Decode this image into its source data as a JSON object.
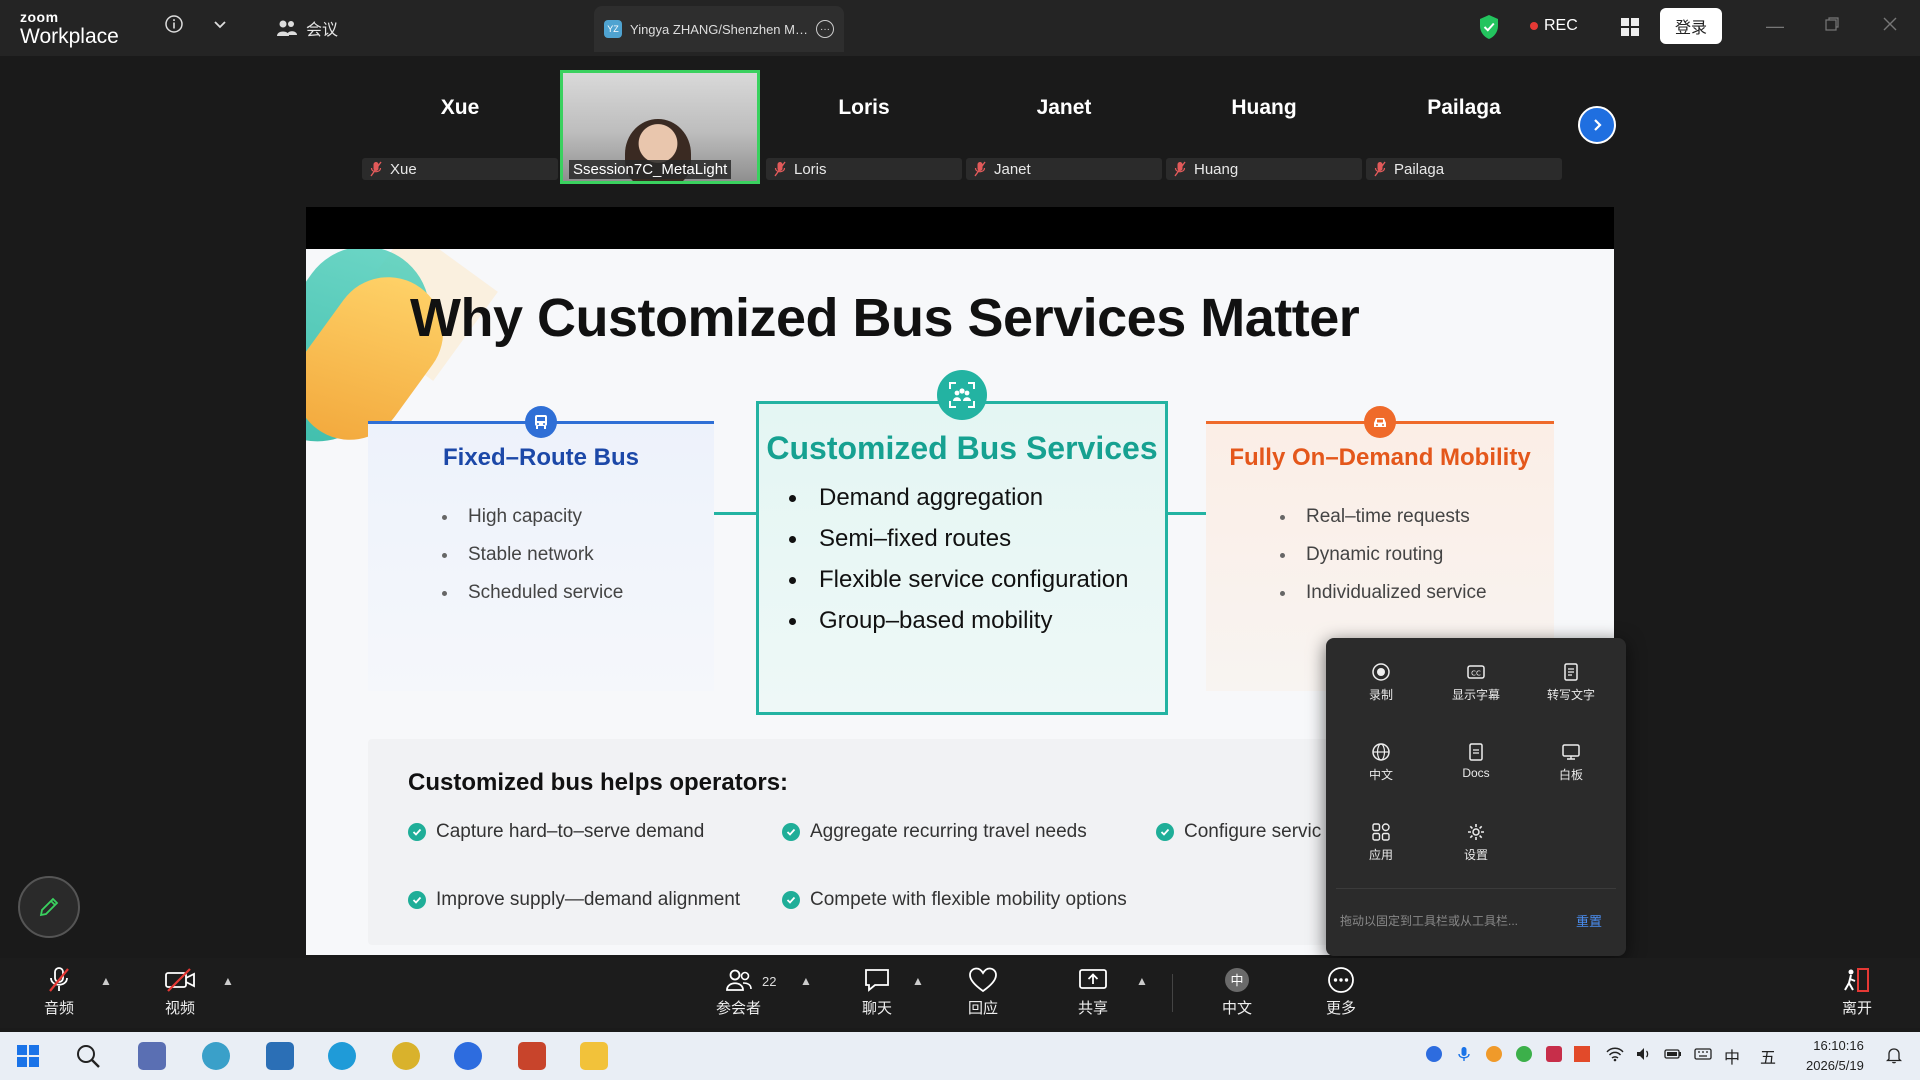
{
  "app": {
    "brand_small": "zoom",
    "brand_big": "Workplace"
  },
  "header": {
    "meeting_label": "会议",
    "tab_badge": "YZ",
    "tab_title": "Yingya ZHANG/Shenzhen Metrol",
    "rec_label": "REC",
    "login_label": "登录"
  },
  "participants": [
    {
      "name": "Xue",
      "label": "Xue"
    },
    {
      "name": "Loris",
      "label": "Loris"
    },
    {
      "name": "Janet",
      "label": "Janet"
    },
    {
      "name": "Huang",
      "label": "Huang"
    },
    {
      "name": "Pailaga",
      "label": "Pailaga"
    }
  ],
  "active_video": {
    "label": "Ssession7C_MetaLight"
  },
  "slide": {
    "title": "Why Customized Bus Services Matter",
    "left": {
      "title": "Fixed–Route Bus",
      "items": [
        "High capacity",
        "Stable network",
        "Scheduled service"
      ]
    },
    "center": {
      "title": "Customized Bus Services",
      "items": [
        "Demand aggregation",
        "Semi–fixed routes",
        "Flexible service configuration",
        "Group–based mobility"
      ]
    },
    "right": {
      "title": "Fully On–Demand Mobility",
      "items": [
        "Real–time requests",
        "Dynamic routing",
        "Individualized service"
      ]
    },
    "ops_title": "Customized bus helps operators:",
    "ops_items": [
      "Capture hard–to–serve demand",
      "Aggregate recurring travel needs",
      "Configure servic",
      "Improve supply—demand alignment",
      "Compete with flexible mobility options"
    ],
    "colors": {
      "left": "#2f6fd6",
      "center": "#23b3a2",
      "right": "#ef6a2a"
    }
  },
  "more_menu": {
    "items": [
      "录制",
      "显示字幕",
      "转写文字",
      "中文",
      "Docs",
      "白板",
      "应用",
      "设置"
    ],
    "hint": "拖动以固定到工具栏或从工具栏...",
    "reset": "重置"
  },
  "toolbar": {
    "audio": "音频",
    "video": "视频",
    "participants": "参会者",
    "participants_count": "22",
    "chat": "聊天",
    "react": "回应",
    "share": "共享",
    "language": "中文",
    "more": "更多",
    "leave": "离开"
  },
  "taskbar": {
    "time": "16:10:16",
    "date": "2026/5/19",
    "ime1": "中",
    "ime2": "五"
  }
}
